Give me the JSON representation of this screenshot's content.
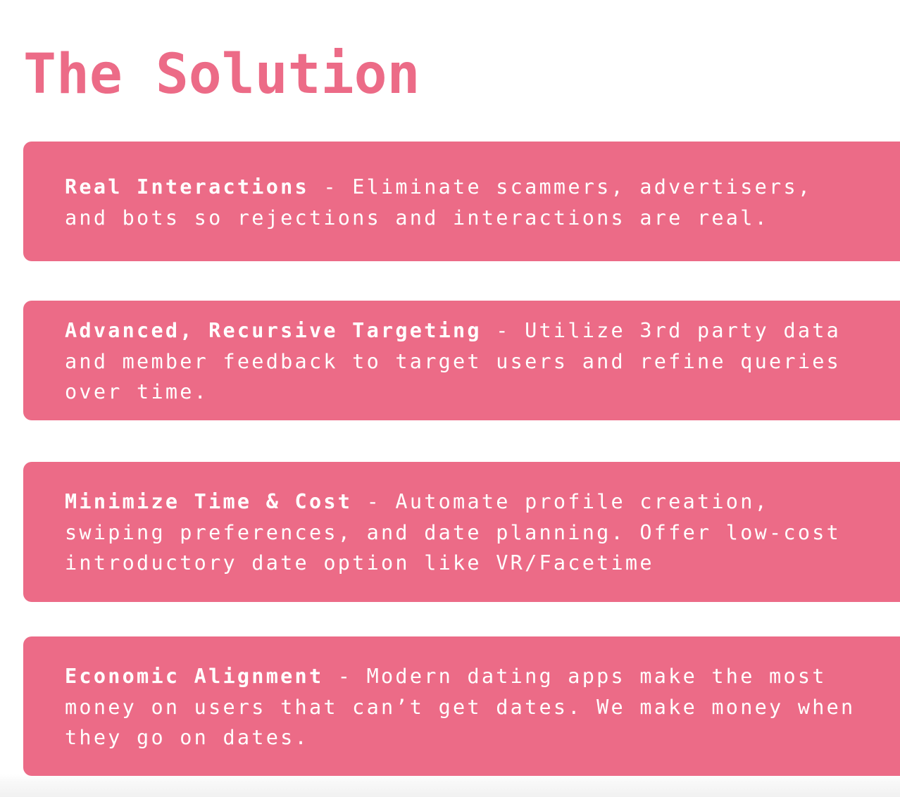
{
  "colors": {
    "accent": "#ec6b87",
    "card_text": "#ffffff",
    "background": "#ffffff"
  },
  "page": {
    "title": "The Solution"
  },
  "cards": [
    {
      "heading": "Real Interactions",
      "separator": " - ",
      "lines": [
        "Eliminate scammers, advertisers,",
        "and bots so rejections and interactions are real."
      ]
    },
    {
      "heading": "Advanced, Recursive Targeting",
      "separator": " - ",
      "lines": [
        "Utilize 3rd party data",
        "and member feedback to target users and refine queries",
        "over time."
      ]
    },
    {
      "heading": "Minimize Time & Cost",
      "separator": " - ",
      "lines": [
        "Automate profile creation,",
        "swiping preferences, and date planning. Offer low-cost",
        "introductory date option like VR/Facetime"
      ]
    },
    {
      "heading": "Economic Alignment",
      "separator": " - ",
      "lines": [
        "Modern dating apps make the most",
        "money on users that can’t get dates. We make money when",
        "they go on dates."
      ]
    }
  ]
}
